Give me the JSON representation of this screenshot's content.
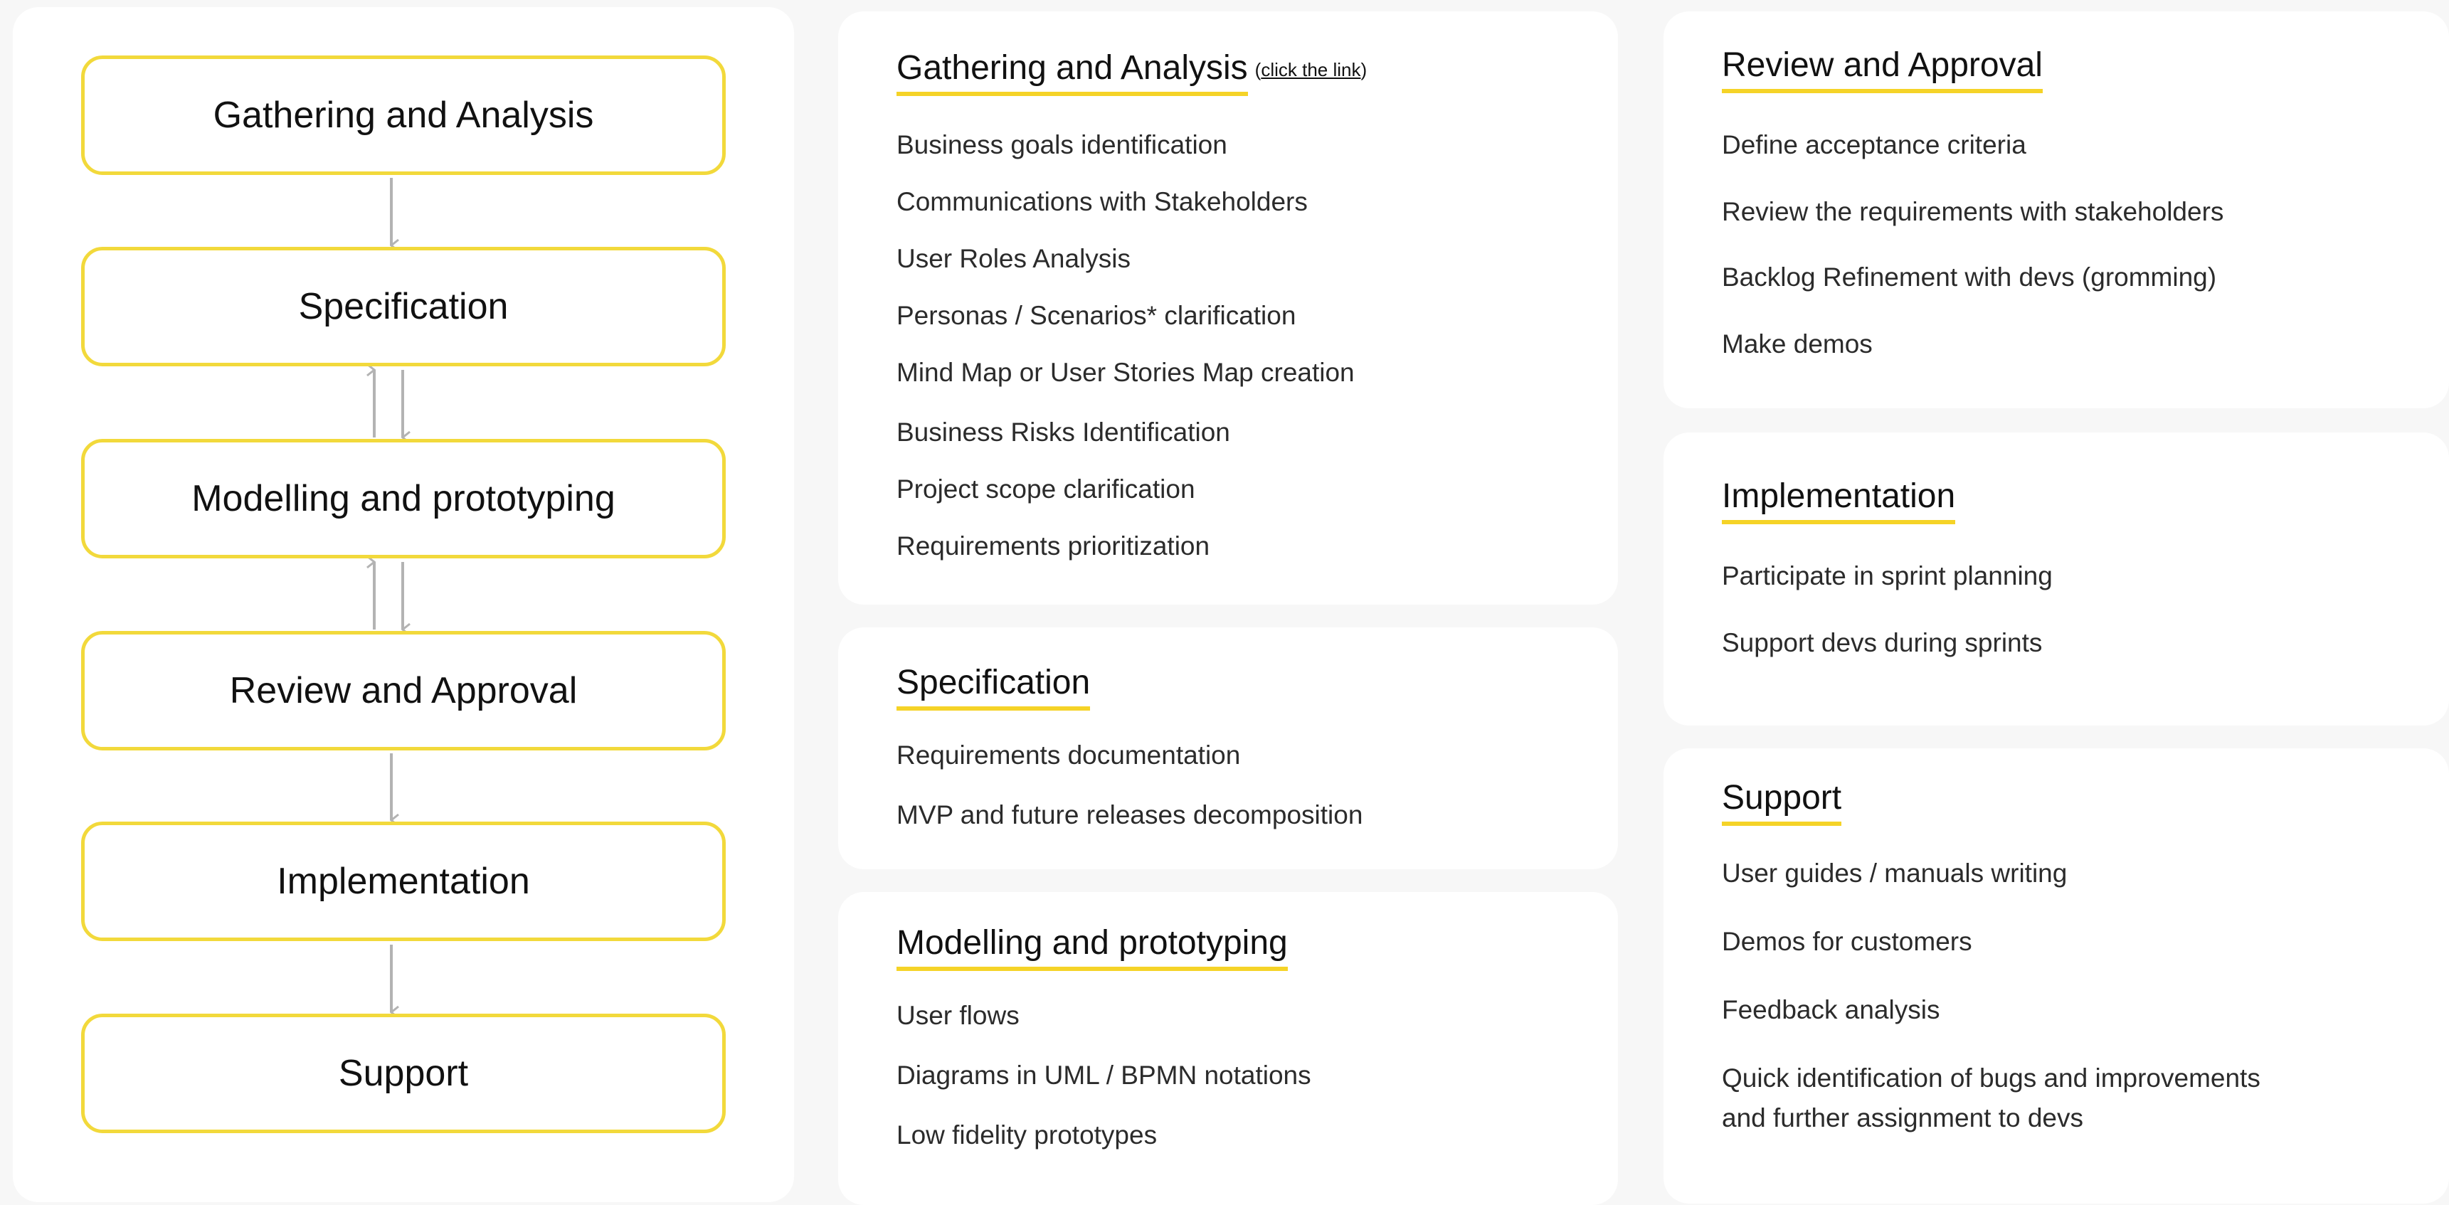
{
  "flow": {
    "stages": [
      "Gathering and Analysis",
      "Specification",
      "Modelling and prototyping",
      "Review and Approval",
      "Implementation",
      "Support"
    ]
  },
  "cards": {
    "gathering": {
      "title": "Gathering and Analysis",
      "link_open": "(",
      "link_text": "click the link",
      "link_close": ")",
      "items": [
        "Business goals identification",
        "Communications with Stakeholders",
        "User Roles Analysis",
        "Personas / Scenarios* clarification",
        "Mind Map or User Stories Map creation",
        "Business Risks Identification",
        "Project scope clarification",
        "Requirements prioritization"
      ]
    },
    "specification": {
      "title": "Specification",
      "items": [
        "Requirements documentation",
        "MVP and future releases decomposition"
      ]
    },
    "modelling": {
      "title": "Modelling and prototyping",
      "items": [
        "User flows",
        "Diagrams in UML / BPMN notations",
        "Low fidelity prototypes"
      ]
    },
    "review": {
      "title": "Review and Approval",
      "items": [
        "Define acceptance criteria",
        "Review the requirements with stakeholders",
        "Backlog Refinement with devs (gromming)",
        "Make demos"
      ]
    },
    "implementation": {
      "title": "Implementation",
      "items": [
        "Participate in sprint planning",
        "Support devs during sprints"
      ]
    },
    "support": {
      "title": "Support",
      "items": [
        "User guides / manuals writing",
        "Demos for customers",
        "Feedback analysis",
        "Quick identification of bugs and improvements",
        "and further assignment to devs"
      ]
    }
  },
  "colors": {
    "accent": "#f2d93b",
    "arrow": "#b3b3b3",
    "panel": "#ffffff",
    "background": "#f7f7f7"
  }
}
